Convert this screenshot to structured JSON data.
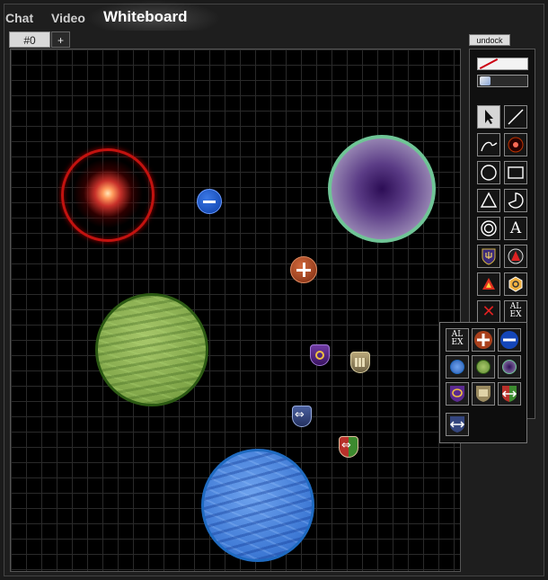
{
  "tabs": {
    "chat": "Chat",
    "video": "Video",
    "whiteboard": "Whiteboard"
  },
  "board_tabs": {
    "current": "#0",
    "add": "+"
  },
  "undock_label": "undock",
  "tools": {
    "text_tool_glyph": "A",
    "alex_text": "AL EX",
    "delete_glyph": "✕"
  },
  "flyout": {
    "alex_text": "AL EX"
  },
  "colors": {
    "accent_red": "#c2120f",
    "planet_green_border": "#2c5a14",
    "planet_blue_border": "#1f6ac0",
    "nebula_border": "#6fc496"
  }
}
